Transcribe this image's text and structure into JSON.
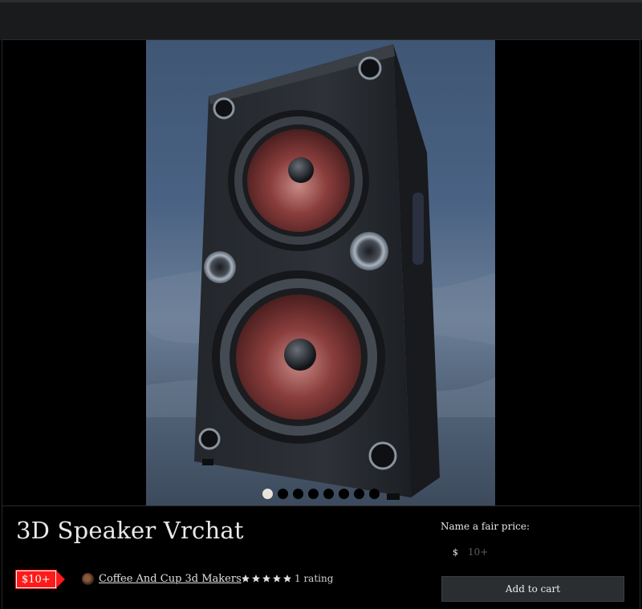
{
  "product": {
    "title": "3D Speaker Vrchat",
    "price_badge": "$10+",
    "author": "Coffee And Cup 3d Makers",
    "rating_count": "1 rating",
    "rating_stars": 5
  },
  "purchase": {
    "fair_price_label": "Name a fair price:",
    "currency": "$",
    "price_placeholder": "10+",
    "add_to_cart_label": "Add to cart"
  },
  "carousel": {
    "slide_count": 8,
    "active_index": 0
  },
  "colors": {
    "accent_badge": "#ff1a1a",
    "background": "#000000",
    "button": "#2b2e31"
  },
  "icons": [
    "star-icon",
    "avatar-icon",
    "speaker-product-image"
  ]
}
